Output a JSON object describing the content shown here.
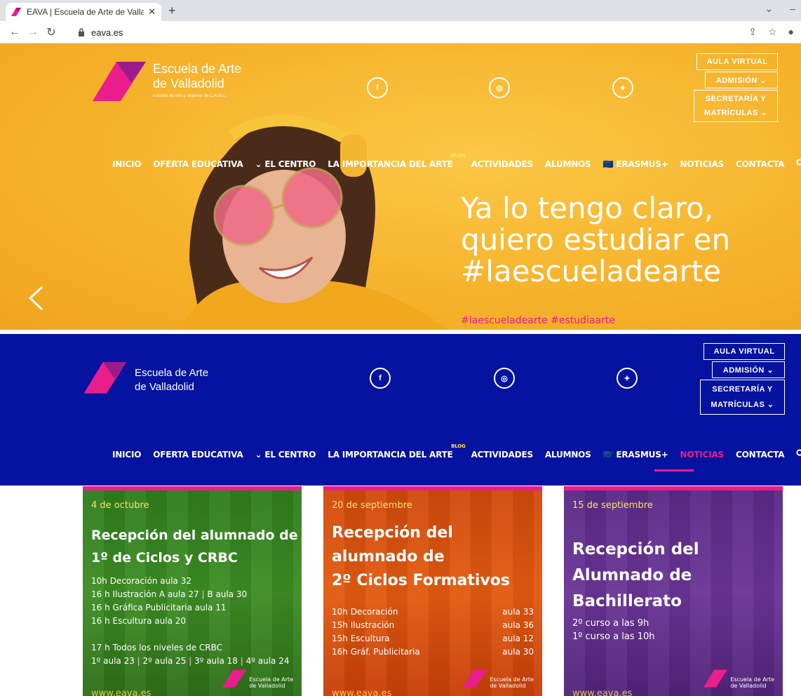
{
  "browser": {
    "tab_title": "EAVA | Escuela de Arte de Vallad",
    "tab_close": "✕",
    "new_tab": "+",
    "url": "eava.es"
  },
  "site": {
    "logo_line1": "Escuela de Arte",
    "logo_line2": "de Valladolid",
    "logo_sub": "Escuela de Arte y Superior de C.R.B.C.",
    "social": {
      "facebook": "f",
      "instagram": "◎",
      "twitter": "✦"
    },
    "buttons": {
      "aula_virtual": "AULA VIRTUAL",
      "admision": "ADMISIÓN ⌄",
      "secretaria_line1": "SECRETARÍA Y",
      "secretaria_line2": "MATRÍCULAS ⌄"
    },
    "menu": {
      "inicio": "INICIO",
      "oferta": "OFERTA EDUCATIVA",
      "centro": "⌄ EL CENTRO",
      "importancia": "LA IMPORTANCIA DEL ARTE",
      "blog": "BLOG",
      "actividades": "ACTIVIDADES",
      "alumnos": "ALUMNOS",
      "erasmus": "🇪🇺 ERASMUS+",
      "noticias": "NOTICIAS",
      "contacta": "CONTACTA",
      "search": "🔍"
    }
  },
  "hero": {
    "headline_line1": "Ya lo tengo claro,",
    "headline_line2": "quiero estudiar en",
    "headline_line3": "#laescueladearte",
    "hashtags": "#laescueladearte #estudiaarte"
  },
  "cards": [
    {
      "date": "4 de octubre",
      "title_line1": "Recepción del alumnado de",
      "title_line2": "1º de Ciclos y CRBC",
      "lines": [
        "10h Decoración aula 32",
        "16 h Ilustración A aula 27",
        "B aula 30",
        "16 h Gráfica Publicitaria aula 11",
        "16 h Escultura aula 20",
        "17 h Todos los niveles de CRBC",
        "1º aula 23",
        "2º aula 25",
        "3º aula 18",
        "4º aula 24"
      ],
      "sep": "|",
      "logo_line1": "Escuela de Arte",
      "logo_line2": "de Valladolid",
      "url": "www.eava.es"
    },
    {
      "date": "20 de septiembre",
      "title_line1": "Recepción del",
      "title_line2": "alumnado de",
      "title_line3": "2º Ciclos Formativos",
      "rows": [
        {
          "name": "10h Decoración",
          "room": "aula 33"
        },
        {
          "name": "15h Ilustración",
          "room": "aula 36"
        },
        {
          "name": "15h Escultura",
          "room": "aula 12"
        },
        {
          "name": "16h Gráf. Publicitaria",
          "room": "aula 30"
        }
      ],
      "logo_line1": "Escuela de Arte",
      "logo_line2": "de Valladolid",
      "url": "www.eava.es"
    },
    {
      "date": "15 de septiembre",
      "title_line1": "Recepción del",
      "title_line2": "Alumnado de",
      "title_line3": "Bachillerato",
      "lines": [
        "2º curso a las 9h",
        "1º curso a las 10h"
      ],
      "logo_line1": "Escuela de Arte",
      "logo_line2": "de Valladolid",
      "url": "www.eava.es"
    }
  ],
  "colors": {
    "magenta": "#e91e8c",
    "hero_yellow": "#f6b32c",
    "header_blue": "#0513a0"
  }
}
